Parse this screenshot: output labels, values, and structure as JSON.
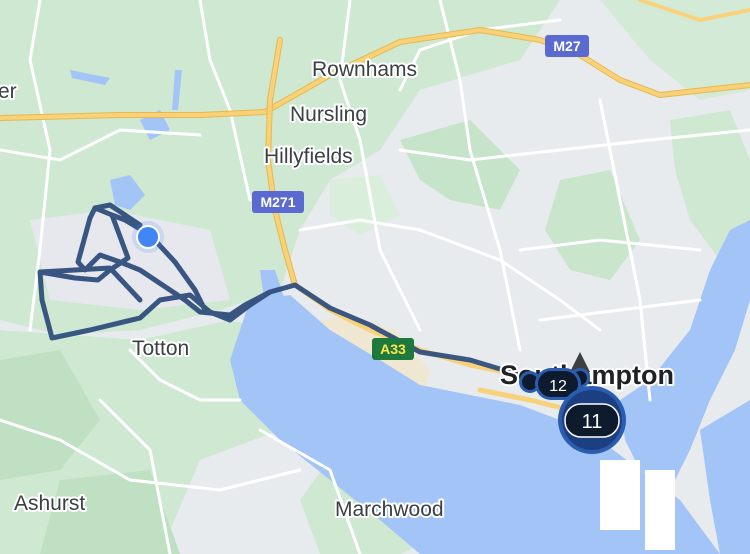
{
  "places": {
    "rownhams": "Rownhams",
    "nursling": "Nursling",
    "hillyfields": "Hillyfields",
    "totton": "Totton",
    "southampton": "Southampton",
    "ashurst": "Ashurst",
    "marchwood": "Marchwood",
    "edge_left": "er"
  },
  "roads": {
    "m27": "M27",
    "m271": "M271",
    "a33": "A33"
  },
  "markers": {
    "cluster_main": "11",
    "cluster_secondary": "12"
  },
  "colors": {
    "water": "#a3c4f7",
    "green": "#c8e6c9",
    "urban": "#e8ebed",
    "motorway": "#f7c85a",
    "route": "#2b4a7a",
    "location_dot": "#4285f4",
    "marker_fill": "#0e1a2e",
    "marker_ring": "#2a5db0"
  }
}
